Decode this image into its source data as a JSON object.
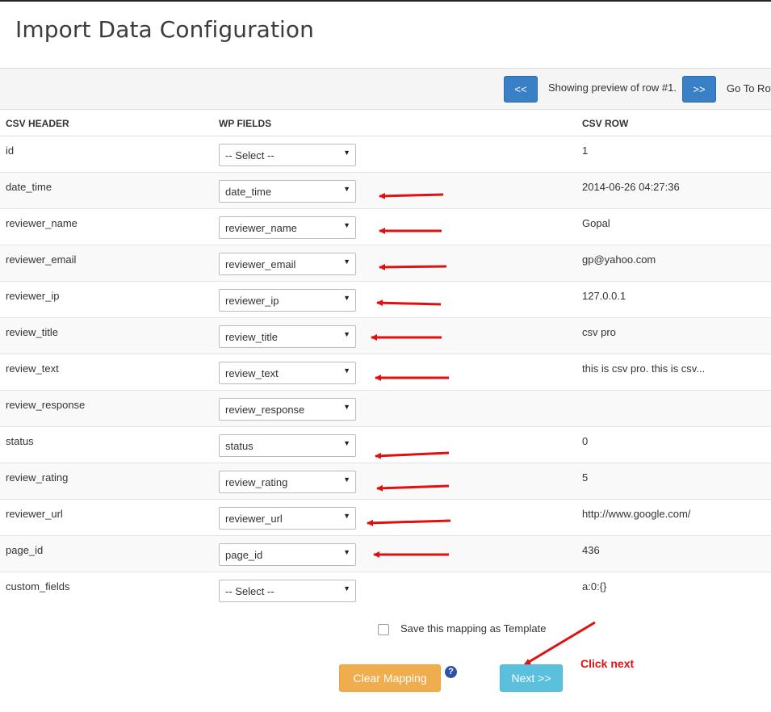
{
  "page": {
    "title": "Import Data Configuration"
  },
  "nav": {
    "prev_label": "<<",
    "next_label": ">>",
    "preview_text": "Showing preview of row #1.",
    "goto_text": "Go To Row"
  },
  "table": {
    "headers": [
      "CSV HEADER",
      "WP FIELDS",
      "CSV ROW"
    ],
    "rows": [
      {
        "csv_header": "id",
        "wp_field": "-- Select --",
        "csv_value": "1"
      },
      {
        "csv_header": "date_time",
        "wp_field": "date_time",
        "csv_value": "2014-06-26 04:27:36"
      },
      {
        "csv_header": "reviewer_name",
        "wp_field": "reviewer_name",
        "csv_value": "Gopal"
      },
      {
        "csv_header": "reviewer_email",
        "wp_field": "reviewer_email",
        "csv_value": "gp@yahoo.com"
      },
      {
        "csv_header": "reviewer_ip",
        "wp_field": "reviewer_ip",
        "csv_value": "127.0.0.1"
      },
      {
        "csv_header": "review_title",
        "wp_field": "review_title",
        "csv_value": "csv pro"
      },
      {
        "csv_header": "review_text",
        "wp_field": "review_text",
        "csv_value": "this is csv pro. this is csv..."
      },
      {
        "csv_header": "review_response",
        "wp_field": "review_response",
        "csv_value": ""
      },
      {
        "csv_header": "status",
        "wp_field": "status",
        "csv_value": "0"
      },
      {
        "csv_header": "review_rating",
        "wp_field": "review_rating",
        "csv_value": "5"
      },
      {
        "csv_header": "reviewer_url",
        "wp_field": "reviewer_url",
        "csv_value": "http://www.google.com/"
      },
      {
        "csv_header": "page_id",
        "wp_field": "page_id",
        "csv_value": "436"
      },
      {
        "csv_header": "custom_fields",
        "wp_field": "-- Select --",
        "csv_value": "a:0:{}"
      }
    ]
  },
  "footer": {
    "save_template_label": "Save this mapping as Template",
    "save_template_checked": false,
    "clear_button": "Clear Mapping",
    "help_icon": "?",
    "next_button": "Next >>",
    "annotation_text": "Click next"
  },
  "colors": {
    "primary_button": "#3a80c6",
    "warning_button": "#f0ad4e",
    "info_button": "#5bc0de",
    "annotation": "#e01010"
  }
}
